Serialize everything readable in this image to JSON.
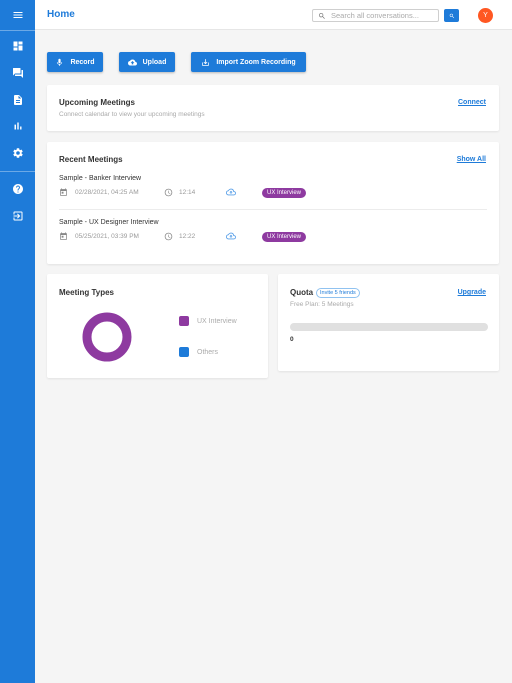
{
  "header": {
    "title": "Home",
    "search_placeholder": "Search all conversations..."
  },
  "user": {
    "initial": "Y",
    "avatar_color": "#ff5722"
  },
  "colors": {
    "primary": "#1e7bd9",
    "tag": "#8e3aa0",
    "others": "#1e7bd9"
  },
  "sidebar": {
    "items": [
      {
        "icon": "menu-icon"
      },
      {
        "icon": "dashboard-icon"
      },
      {
        "icon": "chat-icon"
      },
      {
        "icon": "document-icon"
      },
      {
        "icon": "bar-chart-icon"
      },
      {
        "icon": "settings-icon"
      },
      {
        "icon": "help-icon"
      },
      {
        "icon": "logout-icon"
      }
    ]
  },
  "actions": {
    "record": "Record",
    "upload": "Upload",
    "import_zoom": "Import Zoom Recording"
  },
  "upcoming": {
    "title": "Upcoming Meetings",
    "subtitle": "Connect calendar to view your upcoming meetings",
    "connect": "Connect"
  },
  "recent": {
    "title": "Recent Meetings",
    "show_all": "Show All",
    "meetings": [
      {
        "name": "Sample - Banker Interview",
        "date": "02/28/2021, 04:25 AM",
        "duration": "12:14",
        "tag": "UX Interview"
      },
      {
        "name": "Sample - UX Designer Interview",
        "date": "05/25/2021, 03:39 PM",
        "duration": "12:22",
        "tag": "UX Interview"
      }
    ]
  },
  "meeting_types": {
    "title": "Meeting Types",
    "legend": [
      {
        "label": "UX Interview",
        "color": "#8e3aa0",
        "value": 2
      },
      {
        "label": "Others",
        "color": "#1e7bd9",
        "value": 0
      }
    ]
  },
  "quota": {
    "title": "Quota",
    "invite": "Invite 5 friends",
    "plan": "Free Plan: 5 Meetings",
    "upgrade": "Upgrade",
    "used": "0",
    "fraction": 0
  }
}
